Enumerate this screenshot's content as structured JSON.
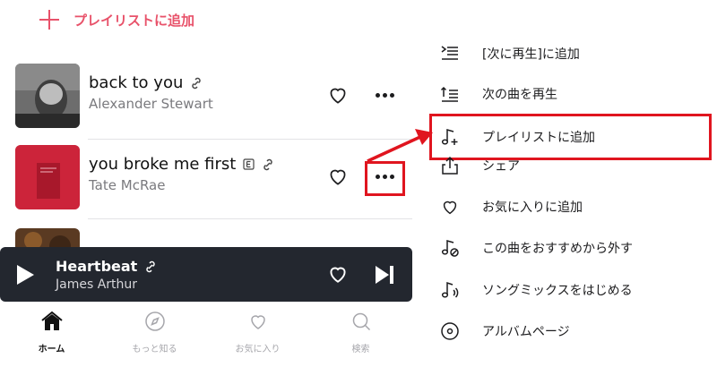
{
  "add_to_playlist_top": {
    "label": "プレイリストに追加"
  },
  "tracks": [
    {
      "title": "back to you",
      "artist": "Alexander Stewart",
      "explicit_badge": false
    },
    {
      "title": "you broke me first",
      "artist": "Tate McRae",
      "explicit_badge": true
    }
  ],
  "now_playing": {
    "title": "Heartbeat",
    "artist": "James Arthur"
  },
  "tabs": [
    {
      "label": "ホーム",
      "icon": "home-icon",
      "active": true
    },
    {
      "label": "もっと知る",
      "icon": "compass-icon",
      "active": false
    },
    {
      "label": "お気に入り",
      "icon": "heart-icon",
      "active": false
    },
    {
      "label": "検索",
      "icon": "search-icon",
      "active": false
    }
  ],
  "context_menu": {
    "items": [
      {
        "label": "[次に再生]に追加",
        "icon": "play-next-queue-icon"
      },
      {
        "label": "次の曲を再生",
        "icon": "play-next-icon"
      },
      {
        "label": "プレイリストに追加",
        "icon": "music-note-plus-icon",
        "highlighted": true
      },
      {
        "label": "シェア",
        "icon": "share-icon"
      },
      {
        "label": "お気に入りに追加",
        "icon": "heart-icon"
      },
      {
        "label": "この曲をおすすめから外す",
        "icon": "music-note-block-icon"
      },
      {
        "label": "ソングミックスをはじめる",
        "icon": "song-mix-icon"
      },
      {
        "label": "アルバムページ",
        "icon": "album-icon"
      }
    ]
  },
  "colors": {
    "accent_pink": "#e8526a",
    "highlight_red": "#e0151f",
    "player_bg": "#23272f"
  }
}
